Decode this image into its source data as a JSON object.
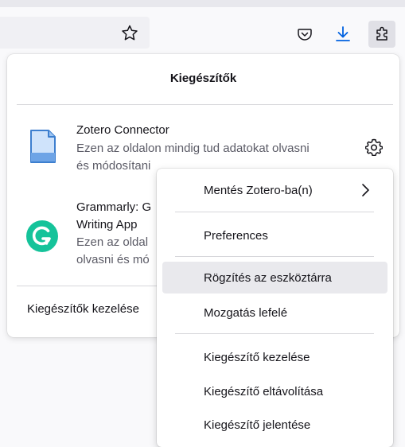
{
  "panel": {
    "title": "Kiegészítők",
    "extensions": [
      {
        "name": "Zotero Connector",
        "description": "Ezen az oldalon mindig tud adatokat olvasni és módosítani",
        "icon": "zotero-document-icon"
      },
      {
        "name_line1": "Grammarly: G",
        "name_line2": "Writing App",
        "desc_line1": "Ezen az oldal",
        "desc_line2": "olvasni és mó",
        "icon": "grammarly-icon"
      }
    ],
    "manage_label": "Kiegészítők kezelése"
  },
  "context_menu": {
    "items": [
      {
        "label": "Mentés Zotero-ba(n)"
      },
      {
        "label": "Preferences"
      },
      {
        "label": "Rögzítés az eszköztárra"
      },
      {
        "label": "Mozgatás lefelé"
      },
      {
        "label": "Kiegészítő kezelése"
      },
      {
        "label": "Kiegészítő eltávolítása"
      },
      {
        "label": "Kiegészítő jelentése"
      }
    ]
  },
  "colors": {
    "accent_blue": "#0061e0",
    "grammarly_green": "#15c39a",
    "zotero_blue": "#3d7fcf"
  }
}
